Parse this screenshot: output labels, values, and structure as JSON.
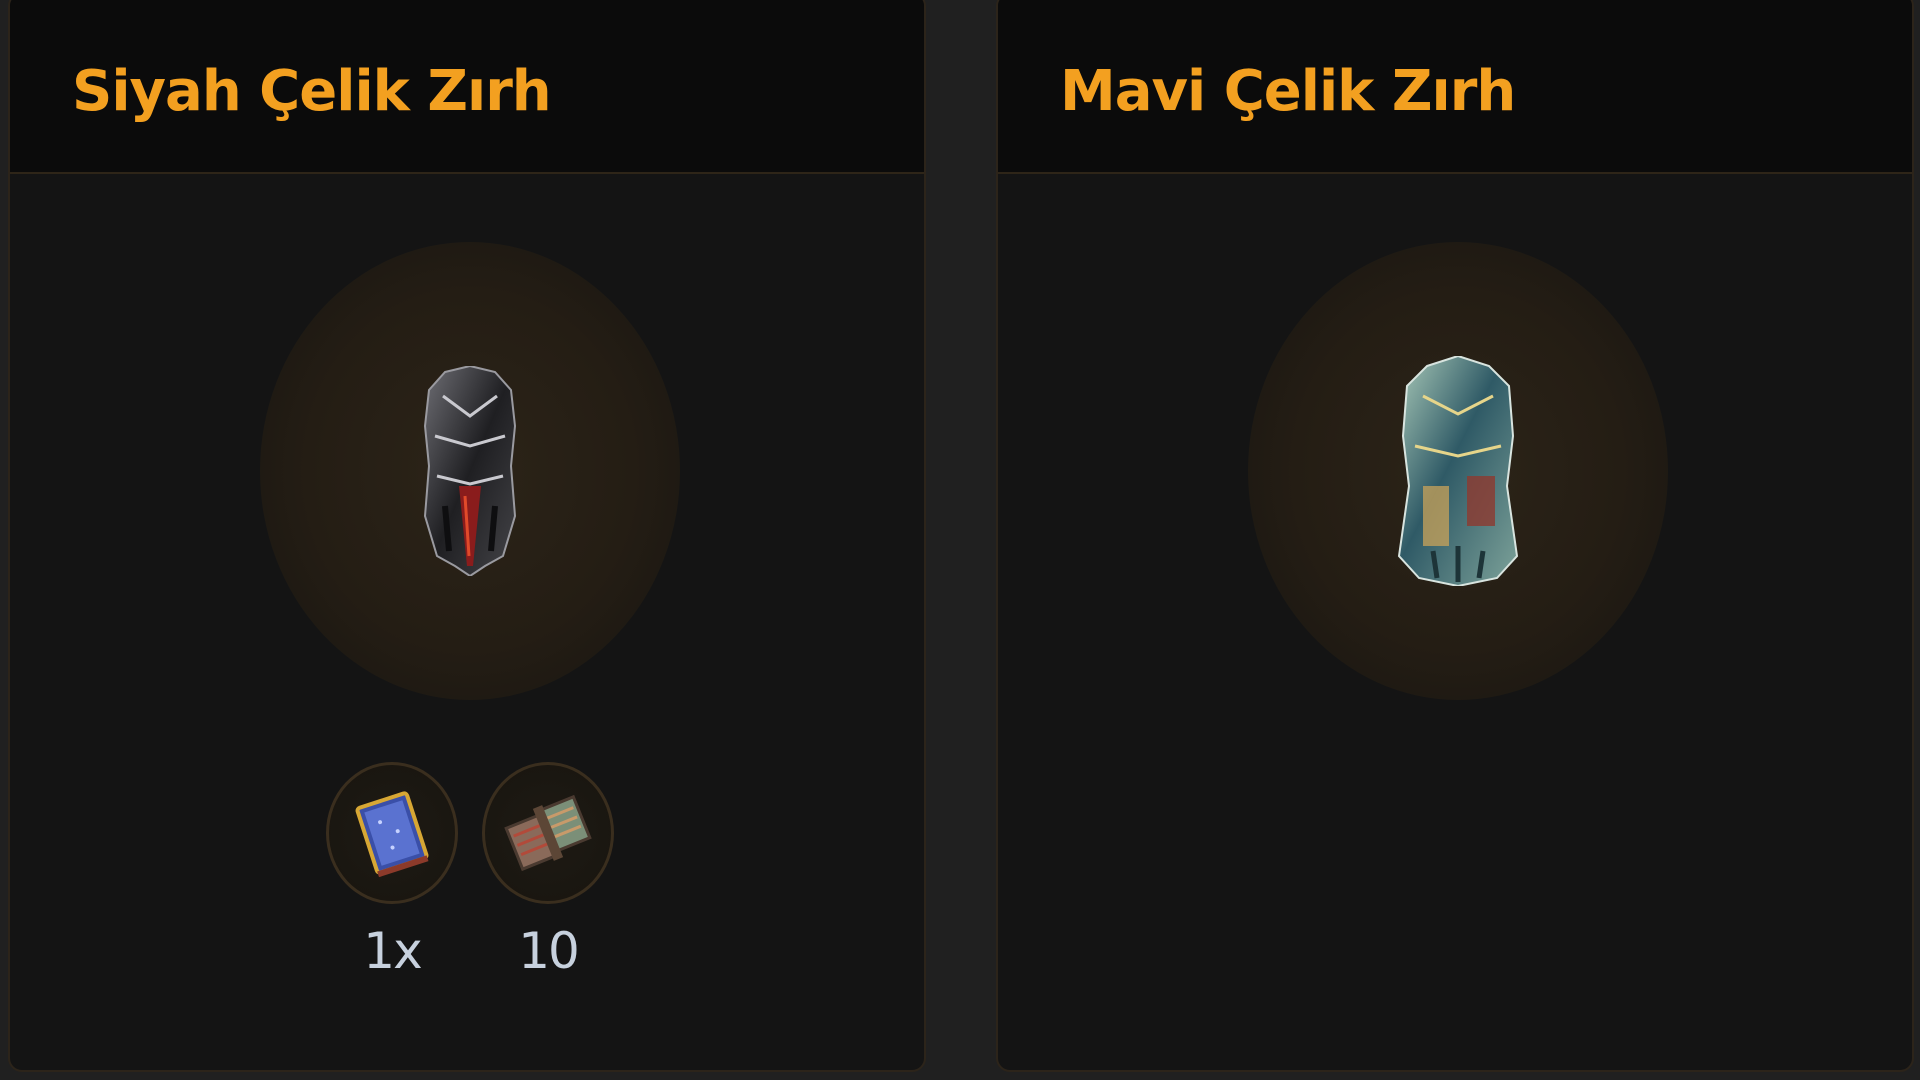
{
  "cards": [
    {
      "title": "Siyah Çelik Zırh",
      "item_icon": "black-steel-armor-icon",
      "materials": [
        {
          "icon": "blue-book-icon",
          "quantity": "1x"
        },
        {
          "icon": "cloth-bundle-icon",
          "quantity": "10"
        }
      ]
    },
    {
      "title": "Mavi Çelik Zırh",
      "item_icon": "blue-steel-armor-icon",
      "materials": []
    }
  ],
  "colors": {
    "title": "#f3a020",
    "card_bg": "#141414",
    "header_bg": "#0b0b0b",
    "border": "#2c241a",
    "quantity_text": "#c7d1de"
  }
}
